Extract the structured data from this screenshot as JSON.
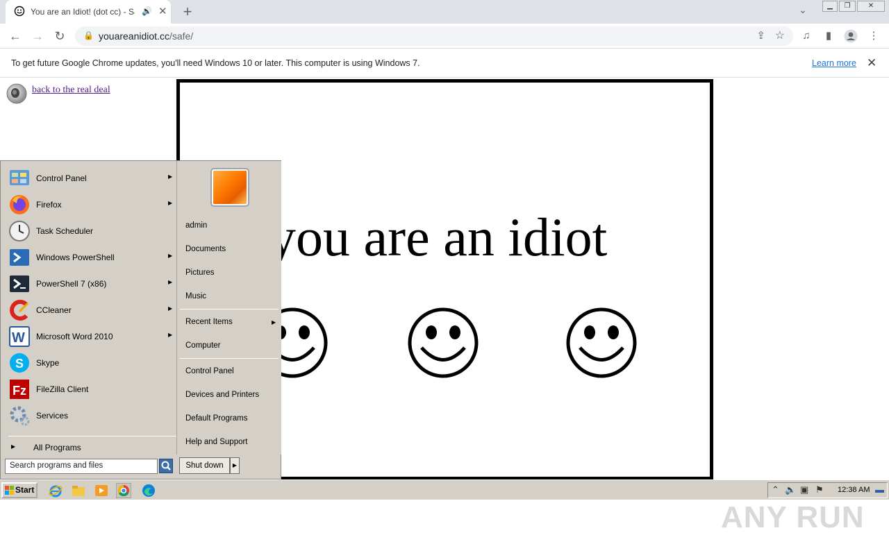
{
  "browser": {
    "tab_title": "You are an Idiot! (dot cc) - Safe",
    "url_host": "youareanidiot.cc",
    "url_path": "/safe/",
    "infobar_message": "To get future Google Chrome updates, you'll need Windows 10 or later. This computer is using Windows 7.",
    "infobar_link": "Learn more"
  },
  "page": {
    "back_link": "back to the real deal",
    "headline": "you are an idiot"
  },
  "start_menu": {
    "programs": [
      {
        "label": "Control Panel",
        "icon": "control-panel-icon",
        "has_submenu": true
      },
      {
        "label": "Firefox",
        "icon": "firefox-icon",
        "has_submenu": true
      },
      {
        "label": "Task Scheduler",
        "icon": "task-scheduler-icon",
        "has_submenu": false
      },
      {
        "label": "Windows PowerShell",
        "icon": "powershell-icon",
        "has_submenu": true
      },
      {
        "label": "PowerShell 7 (x86)",
        "icon": "powershell7-icon",
        "has_submenu": true
      },
      {
        "label": "CCleaner",
        "icon": "ccleaner-icon",
        "has_submenu": true
      },
      {
        "label": "Microsoft Word 2010",
        "icon": "word-icon",
        "has_submenu": true
      },
      {
        "label": "Skype",
        "icon": "skype-icon",
        "has_submenu": false
      },
      {
        "label": "FileZilla Client",
        "icon": "filezilla-icon",
        "has_submenu": false
      },
      {
        "label": "Services",
        "icon": "services-icon",
        "has_submenu": false
      }
    ],
    "all_programs": "All Programs",
    "right_items": {
      "admin": "admin",
      "documents": "Documents",
      "pictures": "Pictures",
      "music": "Music",
      "recent_items": "Recent Items",
      "computer": "Computer",
      "control_panel": "Control Panel",
      "devices_printers": "Devices and Printers",
      "default_programs": "Default Programs",
      "help_support": "Help and Support"
    },
    "search_placeholder": "Search programs and files",
    "shutdown": "Shut down"
  },
  "taskbar": {
    "start": "Start",
    "clock": "12:38 AM"
  },
  "watermark": "ANY RUN"
}
